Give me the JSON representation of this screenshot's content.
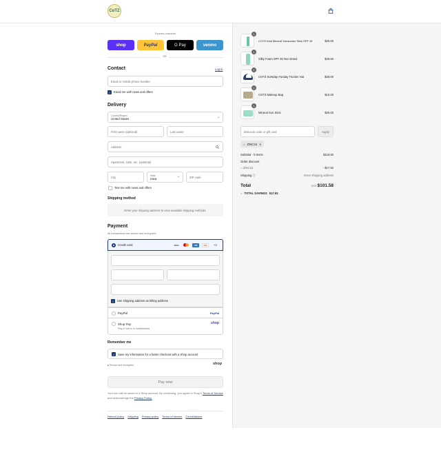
{
  "header": {
    "logo_text": "CoTZ",
    "logo_alt": "COTZ skin care logo",
    "cart_icon": "shopping-bag-icon"
  },
  "express": {
    "label": "Express checkout",
    "buttons": [
      {
        "label": "shop",
        "color": "#5a31f4"
      },
      {
        "label": "PayPal",
        "color": "#ffc439"
      },
      {
        "label": "G Pay",
        "color": "#000000"
      },
      {
        "label": "venmo",
        "color": "#3d95ce"
      }
    ],
    "or": "OR"
  },
  "contact": {
    "title": "Contact",
    "login": "Log in",
    "email_placeholder": "Email or mobile phone number",
    "newsletter": "Email me with news and offers"
  },
  "delivery": {
    "title": "Delivery",
    "country_label": "Country/Region",
    "country_value": "United States",
    "first_name": "First name (optional)",
    "last_name": "Last name",
    "address": "Address",
    "apartment": "Apartment, suite, etc. (optional)",
    "city": "City",
    "state_label": "State",
    "state_value": "Iowa",
    "zip": "ZIP code",
    "text_me": "Text me with news and offers"
  },
  "shipping_method": {
    "title": "Shipping method",
    "message": "Enter your shipping address to view available shipping methods."
  },
  "payment": {
    "title": "Payment",
    "subtitle": "All transactions are secure and encrypted.",
    "credit_card": "Credit card",
    "more_cards": "+3",
    "billing_same": "Use shipping address as billing address",
    "paypal": "PayPal",
    "paypal_logo": "PayPal",
    "shop_pay": "Shop Pay",
    "shop_pay_sub": "Pay in full or in installments",
    "shop_pay_logo": "shop"
  },
  "remember": {
    "title": "Remember me",
    "save_info": "Save my information for a faster checkout with a Shop account",
    "secure": "Secure and encrypted",
    "shop_logo": "shop"
  },
  "pay_now": "Pay now",
  "legal": {
    "line1": "Your info will be saved to a Shop account. By continuing, you agree to Shop's",
    "terms": "Terms of Service",
    "and": "and acknowledge the",
    "privacy": "Privacy Policy."
  },
  "footer_links": [
    "Refund policy",
    "Shipping",
    "Privacy policy",
    "Terms of service",
    "Cancellations"
  ],
  "cart": {
    "items": [
      {
        "name": "COTZ Kids Mineral Sunscreen Stick SPF 45",
        "price": "$26.00",
        "qty": "1"
      },
      {
        "name": "Silky Foam SPF 30 Non-tinted",
        "price": "$29.50",
        "qty": "1"
      },
      {
        "name": "COTZ SUNday Funday Trucker Hat",
        "price": "$28.00",
        "qty": "1"
      },
      {
        "name": "COTZ Makeup Bag",
        "price": "$10.00",
        "qty": "1"
      },
      {
        "name": "Mineral Sun Stick",
        "price": "$26.00",
        "qty": "1"
      }
    ],
    "discount_placeholder": "Discount code or gift card",
    "apply": "Apply",
    "code_tag": "ZINC15",
    "subtotal_label": "Subtotal · 5 items",
    "subtotal_value": "$119.50",
    "order_discount_label": "Order discount",
    "discount_code": "ZINC15",
    "discount_value": "- $17.92",
    "shipping_label": "Shipping",
    "shipping_value": "Enter shipping address",
    "total_label": "Total",
    "currency": "USD",
    "total_value": "$101.58",
    "savings_label": "TOTAL SAVINGS",
    "savings_value": "$17.92"
  }
}
